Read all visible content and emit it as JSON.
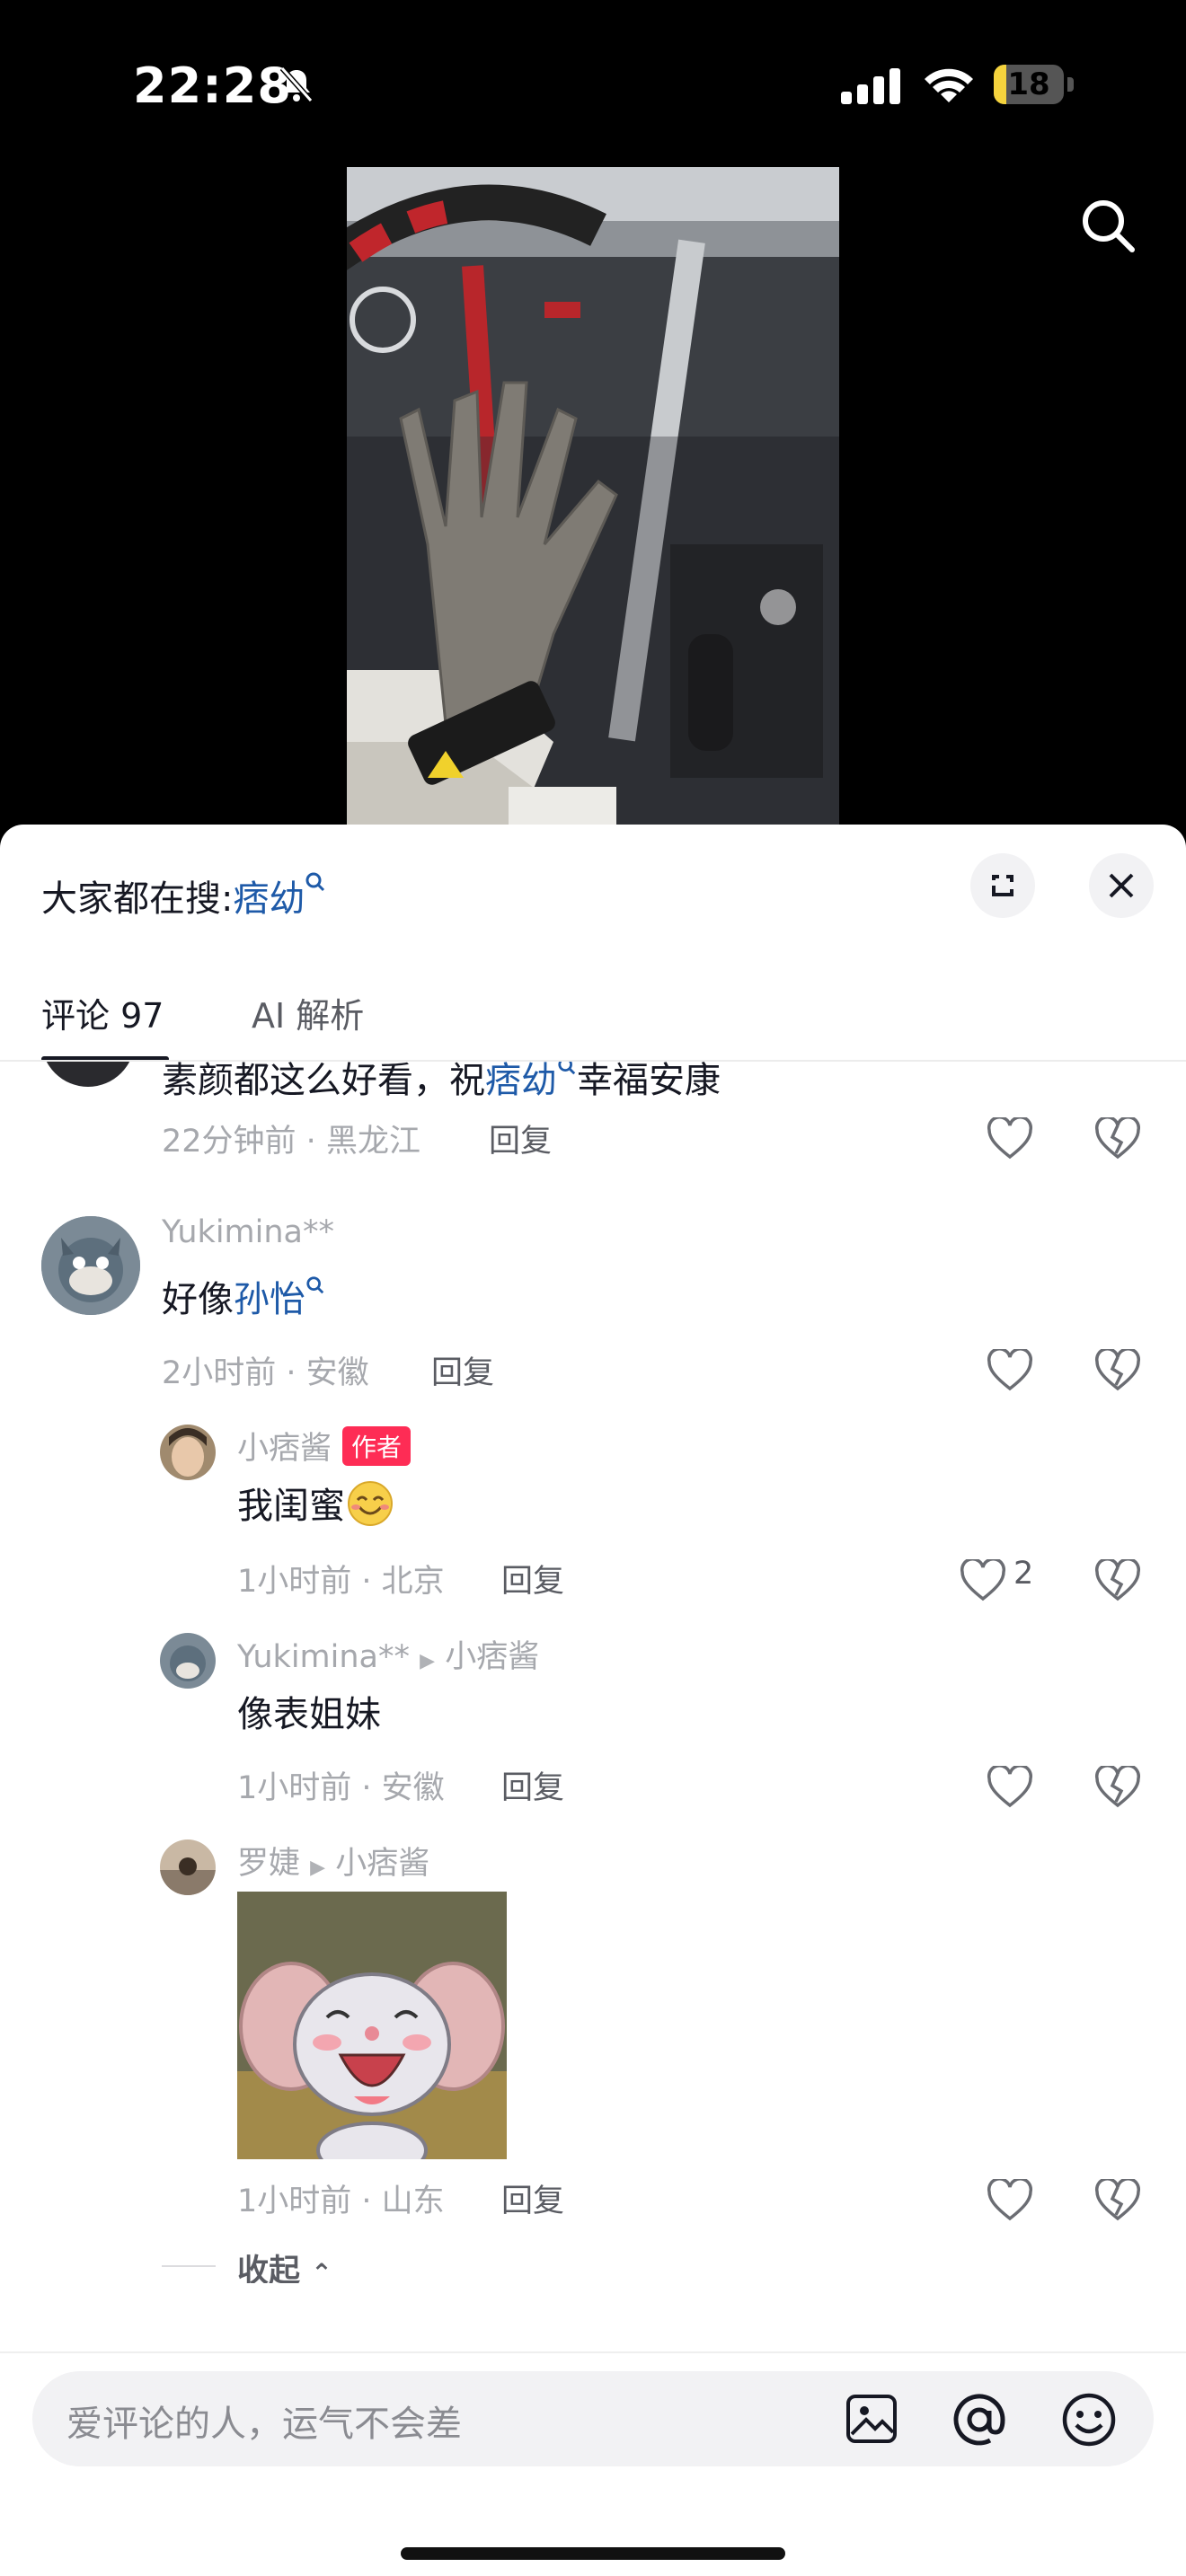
{
  "status_bar": {
    "time": "22:28",
    "battery": "18",
    "battery_level": 0.18
  },
  "header": {
    "hot_search_label": "大家都在搜:",
    "hot_search_term": "痞幼"
  },
  "tabs": [
    {
      "label": "评论 97"
    },
    {
      "label": "AI 解析"
    }
  ],
  "comments": [
    {
      "text_prefix": "素颜都这么好看，祝",
      "text_link": "痞幼",
      "text_suffix": "幸福安康",
      "time": "22分钟前",
      "location": "黑龙江",
      "reply_label": "回复"
    },
    {
      "username": "Yukimina**",
      "text_prefix": "好像",
      "text_link": "孙怡",
      "time": "2小时前",
      "location": "安徽",
      "reply_label": "回复",
      "replies": [
        {
          "username": "小痞酱",
          "badge": "作者",
          "text": "我闺蜜",
          "time": "1小时前",
          "location": "北京",
          "reply_label": "回复",
          "likes": "2"
        },
        {
          "username": "Yukimina**",
          "reply_to": "小痞酱",
          "text": "像表姐妹",
          "time": "1小时前",
          "location": "安徽",
          "reply_label": "回复"
        },
        {
          "username": "罗婕",
          "reply_to": "小痞酱",
          "time": "1小时前",
          "location": "山东",
          "reply_label": "回复"
        }
      ]
    }
  ],
  "collapse_label": "收起",
  "input": {
    "placeholder": "爱评论的人，运气不会差"
  },
  "colors": {
    "link": "#1e5aa8",
    "badge": "#fe2c55",
    "sheet": "#ffffff",
    "background": "#000000"
  }
}
